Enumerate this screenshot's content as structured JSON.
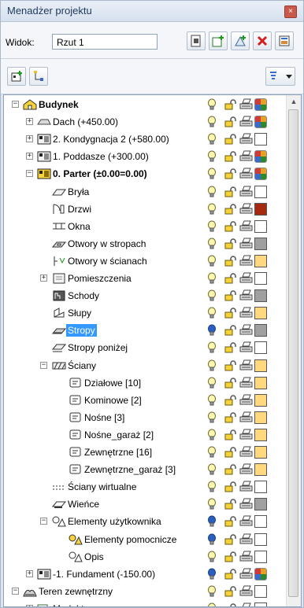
{
  "window": {
    "title": "Menadżer projektu",
    "close_glyph": "×"
  },
  "view": {
    "label": "Widok:",
    "value": "Rzut 1"
  },
  "colors": {
    "accent": "#3399ff",
    "dark_red": "#a52a10",
    "gray": "#a0a0a0",
    "yellow": "#ffd880"
  },
  "tree": [
    {
      "label": "Budynek",
      "depth": 0,
      "expander": "minus",
      "icon": "house-icon",
      "bold": true,
      "bulb": "yellow",
      "swatch": "multi"
    },
    {
      "label": "Dach (+450.00)",
      "depth": 1,
      "expander": "plus",
      "icon": "roof-icon",
      "bulb": "yellow",
      "swatch": "multi"
    },
    {
      "label": "2. Kondygnacja 2 (+580.00)",
      "depth": 1,
      "expander": "plus",
      "icon": "floor-icon",
      "bulb": "yellow",
      "swatch": "white"
    },
    {
      "label": "1. Poddasze (+300.00)",
      "depth": 1,
      "expander": "plus",
      "icon": "floor-icon",
      "bulb": "yellow",
      "swatch": "multi"
    },
    {
      "label": "0. Parter (±0.00=0.00)",
      "depth": 1,
      "expander": "minus",
      "icon": "floor-active-icon",
      "bold": true,
      "bulb": "yellow",
      "swatch": "multi"
    },
    {
      "label": "Bryła",
      "depth": 2,
      "expander": "none",
      "icon": "solid-icon",
      "bulb": "yellow",
      "swatch": "white"
    },
    {
      "label": "Drzwi",
      "depth": 2,
      "expander": "none",
      "icon": "door-icon",
      "bulb": "yellow",
      "swatch": "darkred"
    },
    {
      "label": "Okna",
      "depth": 2,
      "expander": "none",
      "icon": "window-icon",
      "bulb": "yellow",
      "swatch": "white"
    },
    {
      "label": "Otwory w stropach",
      "depth": 2,
      "expander": "none",
      "icon": "slab-opening-icon",
      "bulb": "yellow",
      "swatch": "gray"
    },
    {
      "label": "Otwory w ścianach",
      "depth": 2,
      "expander": "none",
      "icon": "wall-opening-icon",
      "bulb": "yellow",
      "swatch": "yellow"
    },
    {
      "label": "Pomieszczenia",
      "depth": 2,
      "expander": "plus",
      "icon": "room-icon",
      "bulb": "yellow",
      "swatch": "white"
    },
    {
      "label": "Schody",
      "depth": 2,
      "expander": "none",
      "icon": "stairs-icon",
      "bulb": "yellow",
      "swatch": "gray"
    },
    {
      "label": "Słupy",
      "depth": 2,
      "expander": "none",
      "icon": "column-icon",
      "bulb": "yellow",
      "swatch": "yellow"
    },
    {
      "label": "Stropy",
      "depth": 2,
      "expander": "none",
      "icon": "slab-icon",
      "bulb": "blue",
      "swatch": "gray",
      "selected": true
    },
    {
      "label": "Stropy poniżej",
      "depth": 2,
      "expander": "none",
      "icon": "slab-below-icon",
      "bulb": "yellow",
      "swatch": "white"
    },
    {
      "label": "Ściany",
      "depth": 2,
      "expander": "minus",
      "icon": "wall-icon",
      "bulb": "yellow",
      "swatch": "yellow"
    },
    {
      "label": "Działowe [10]",
      "depth": 3,
      "expander": "none",
      "icon": "wall-type-icon",
      "bulb": "yellow",
      "swatch": "yellow"
    },
    {
      "label": "Kominowe [2]",
      "depth": 3,
      "expander": "none",
      "icon": "wall-type-icon",
      "bulb": "yellow",
      "swatch": "yellow"
    },
    {
      "label": "Nośne [3]",
      "depth": 3,
      "expander": "none",
      "icon": "wall-type-icon",
      "bulb": "yellow",
      "swatch": "yellow"
    },
    {
      "label": "Nośne_garaż [2]",
      "depth": 3,
      "expander": "none",
      "icon": "wall-type-icon",
      "bulb": "yellow",
      "swatch": "yellow"
    },
    {
      "label": "Zewnętrzne [16]",
      "depth": 3,
      "expander": "none",
      "icon": "wall-type-icon",
      "bulb": "yellow",
      "swatch": "yellow"
    },
    {
      "label": "Zewnętrzne_garaż [3]",
      "depth": 3,
      "expander": "none",
      "icon": "wall-type-icon",
      "bulb": "yellow",
      "swatch": "yellow"
    },
    {
      "label": "Ściany wirtualne",
      "depth": 2,
      "expander": "none",
      "icon": "virtual-wall-icon",
      "bulb": "yellow",
      "swatch": "white"
    },
    {
      "label": "Wieńce",
      "depth": 2,
      "expander": "none",
      "icon": "ring-beam-icon",
      "bulb": "yellow",
      "swatch": "gray"
    },
    {
      "label": "Elementy użytkownika",
      "depth": 2,
      "expander": "minus",
      "icon": "user-elements-icon",
      "bulb": "blue",
      "swatch": "white"
    },
    {
      "label": "Elementy pomocnicze",
      "depth": 3,
      "expander": "none",
      "icon": "helper-elements-icon",
      "bulb": "blue",
      "swatch": "white"
    },
    {
      "label": "Opis",
      "depth": 3,
      "expander": "none",
      "icon": "description-icon",
      "bulb": "yellow",
      "swatch": "white"
    },
    {
      "label": "-1. Fundament (-150.00)",
      "depth": 1,
      "expander": "plus",
      "icon": "floor-icon",
      "bulb": "blue",
      "swatch": "multi"
    },
    {
      "label": "Teren zewnętrzny",
      "depth": 0,
      "expander": "minus",
      "icon": "terrain-icon",
      "bulb": "yellow",
      "swatch": "white"
    },
    {
      "label": "Model terenu",
      "depth": 1,
      "expander": "plus",
      "icon": "terrain-model-icon",
      "bulb": "yellow",
      "swatch": "white"
    }
  ]
}
